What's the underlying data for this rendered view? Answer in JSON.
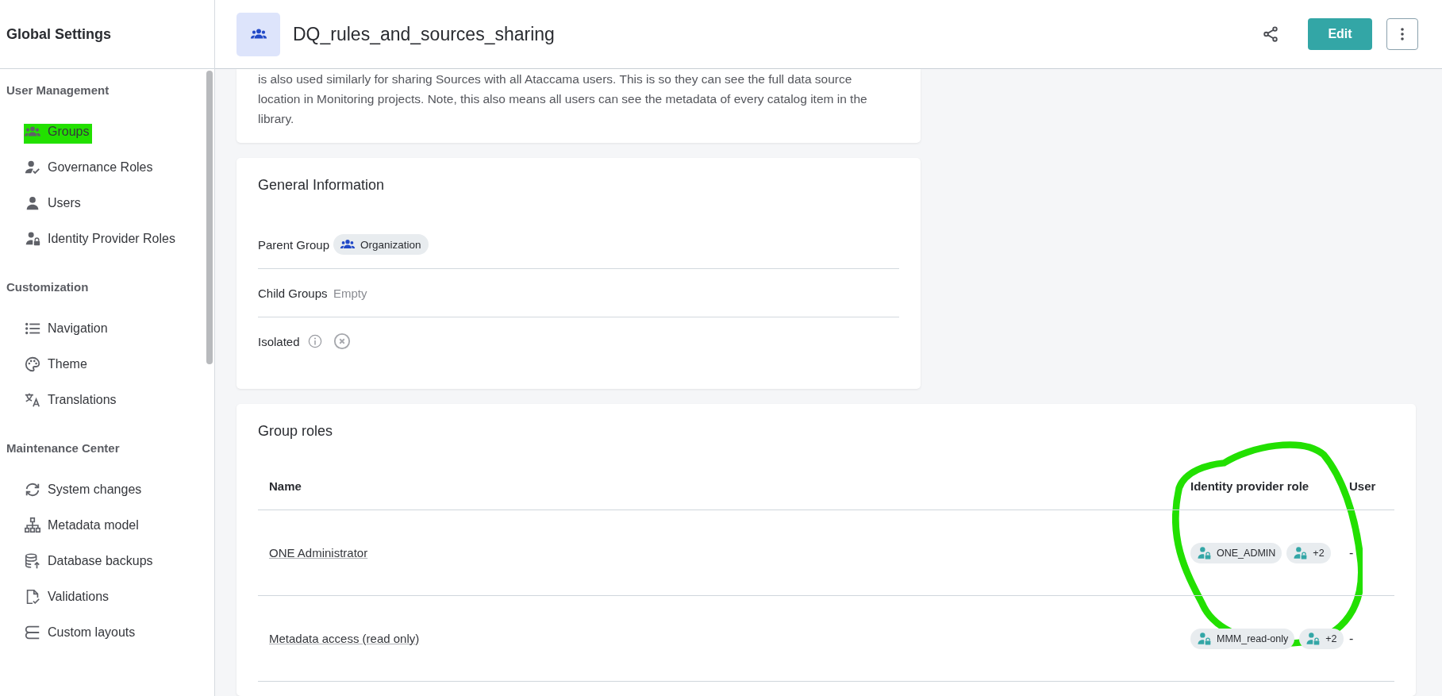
{
  "sidebar": {
    "title": "Global Settings",
    "sections": [
      {
        "heading": "User Management",
        "items": [
          {
            "label": "Groups",
            "kind": "groups",
            "highlighted": true
          },
          {
            "label": "Governance Roles",
            "kind": "governance",
            "highlighted": false
          },
          {
            "label": "Users",
            "kind": "user",
            "highlighted": false
          },
          {
            "label": "Identity Provider Roles",
            "kind": "idp",
            "highlighted": false
          }
        ]
      },
      {
        "heading": "Customization",
        "items": [
          {
            "label": "Navigation",
            "kind": "list",
            "highlighted": false
          },
          {
            "label": "Theme",
            "kind": "palette",
            "highlighted": false
          },
          {
            "label": "Translations",
            "kind": "translate",
            "highlighted": false
          }
        ]
      },
      {
        "heading": "Maintenance Center",
        "items": [
          {
            "label": "System changes",
            "kind": "sync",
            "highlighted": false
          },
          {
            "label": "Metadata model",
            "kind": "hierarchy",
            "highlighted": false
          },
          {
            "label": "Database backups",
            "kind": "database",
            "highlighted": false
          },
          {
            "label": "Validations",
            "kind": "validation",
            "highlighted": false
          },
          {
            "label": "Custom layouts",
            "kind": "layouts",
            "highlighted": false
          }
        ]
      }
    ]
  },
  "header": {
    "title": "DQ_rules_and_sources_sharing",
    "edit_button": "Edit"
  },
  "description": "is also used similarly for sharing Sources with all Ataccama users. This is so they can see the full data source location in Monitoring projects. Note, this also means all users can see the metadata of every catalog item in the library.",
  "general_information": {
    "title": "General Information",
    "parent_group": {
      "label": "Parent Group",
      "value": "Organization"
    },
    "child_groups": {
      "label": "Child Groups",
      "value": "Empty"
    },
    "isolated": {
      "label": "Isolated",
      "value": false
    }
  },
  "group_roles": {
    "title": "Group roles",
    "columns": [
      "Name",
      "Identity provider role",
      "User"
    ],
    "rows": [
      {
        "name": "ONE Administrator",
        "roles": [
          "ONE_ADMIN",
          "+2"
        ],
        "user": "-"
      },
      {
        "name": "Metadata access (read only)",
        "roles": [
          "MMM_read-only",
          "+2"
        ],
        "user": "-"
      }
    ]
  }
}
